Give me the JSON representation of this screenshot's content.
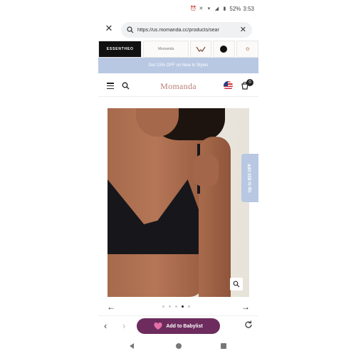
{
  "status_bar": {
    "battery": "52%",
    "time": "3:53",
    "icons": [
      "alarm-icon",
      "mute-icon",
      "wifi-icon",
      "signal-icon",
      "battery-icon"
    ]
  },
  "browser": {
    "url": "https://us.momanda.cc/products/sear",
    "close_icon": "close-icon",
    "clear_icon": "clear-icon"
  },
  "brand_strip": {
    "tiles": [
      "ESSENTHEO",
      "Momanda",
      "",
      "",
      ""
    ]
  },
  "promo": {
    "text": "Get 15% OFF on New In Styles"
  },
  "header": {
    "logo": "Momanda",
    "cart_count": "0"
  },
  "product": {
    "side_tab": "Up to $10 OFF",
    "image_alt": "Black nursing bra product photo"
  },
  "carousel": {
    "dots": 5,
    "active_dot": 4
  },
  "toolbar": {
    "babylist_label": "Add to Babylist"
  },
  "colors": {
    "accent_blue": "#b8c8e3",
    "babylist_purple": "#6d2c5d",
    "logo_rose": "#b77e72"
  }
}
